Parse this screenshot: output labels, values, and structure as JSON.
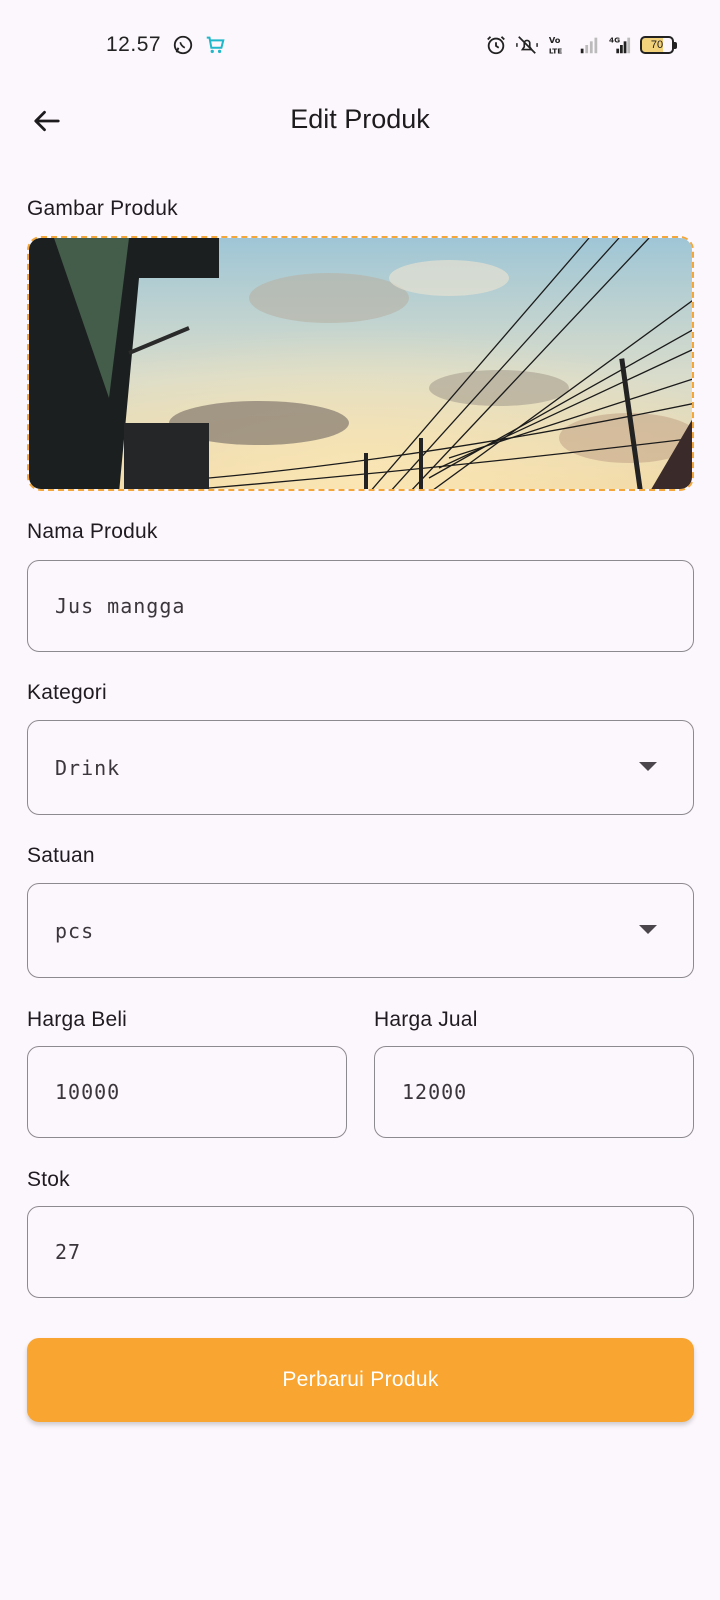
{
  "status_bar": {
    "time": "12.57",
    "battery_level": "70",
    "left_icons": [
      "whatsapp-icon",
      "cart-app-icon"
    ],
    "right_icons": [
      "alarm-icon",
      "vibrate-icon",
      "volte-icon",
      "signal-icon",
      "4g-signal-icon",
      "battery-icon"
    ]
  },
  "app_bar": {
    "title": "Edit Produk",
    "back_icon": "arrow-back-icon"
  },
  "form": {
    "image_label": "Gambar Produk",
    "name_label": "Nama Produk",
    "name_value": "Jus mangga",
    "category_label": "Kategori",
    "category_value": "Drink",
    "unit_label": "Satuan",
    "unit_value": "pcs",
    "buy_price_label": "Harga Beli",
    "buy_price_value": "10000",
    "sell_price_label": "Harga Jual",
    "sell_price_value": "12000",
    "stock_label": "Stok",
    "stock_value": "27",
    "submit_label": "Perbarui Produk"
  },
  "colors": {
    "accent": "#f8a532",
    "background": "#fcf7fc",
    "border": "#8d8a8f"
  }
}
